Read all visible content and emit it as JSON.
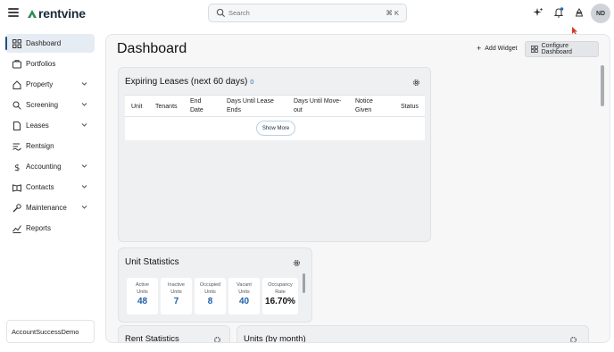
{
  "topbar": {
    "logo": "rentvine",
    "search_placeholder": "Search",
    "search_shortcut": "⌘ K",
    "avatar_initials": "ND",
    "icons": [
      "menu-icon",
      "sparkle-icon",
      "bell-icon",
      "user-icon"
    ],
    "notification_dot_color": "#2a6bb5"
  },
  "sidebar": {
    "items": [
      {
        "label": "Dashboard",
        "icon": "dashboard-icon",
        "active": true
      },
      {
        "label": "Portfolios",
        "icon": "portfolio-icon"
      },
      {
        "label": "Property",
        "icon": "house-icon",
        "expandable": true
      },
      {
        "label": "Screening",
        "icon": "magnifier-icon",
        "expandable": true
      },
      {
        "label": "Leases",
        "icon": "document-icon",
        "expandable": true
      },
      {
        "label": "Rentsign",
        "icon": "sign-icon"
      },
      {
        "label": "Accounting",
        "icon": "dollar-icon",
        "expandable": true
      },
      {
        "label": "Contacts",
        "icon": "contacts-icon",
        "expandable": true
      },
      {
        "label": "Maintenance",
        "icon": "wrench-icon",
        "expandable": true
      },
      {
        "label": "Reports",
        "icon": "chart-icon"
      }
    ],
    "account": "AccountSuccessDemo"
  },
  "main": {
    "title": "Dashboard",
    "add_widget": "Add Widget",
    "configure": "Configure Dashboard",
    "expiring": {
      "title": "Expiring Leases (next 60 days)",
      "count": "0",
      "columns": [
        "Unit",
        "Tenants",
        "End Date",
        "Days Until Lease Ends",
        "Days Until Move-out",
        "Notice Given",
        "Status"
      ],
      "show_more": "Show More"
    },
    "unit_stats": {
      "title": "Unit Statistics",
      "stats": [
        {
          "l1": "Active",
          "l2": "Units",
          "value": "48"
        },
        {
          "l1": "Inactive",
          "l2": "Units",
          "value": "7"
        },
        {
          "l1": "Occupied",
          "l2": "Units",
          "value": "8"
        },
        {
          "l1": "Vacant",
          "l2": "Units",
          "value": "40"
        },
        {
          "l1": "Occupancy",
          "l2": "Rate",
          "value": "16.70%"
        }
      ]
    },
    "bottom_cards": [
      "Rent Statistics",
      "Units (by month)"
    ]
  },
  "colors": {
    "accent": "#1f5fa8",
    "brand_green": "#2e8b57",
    "active_nav_bg": "#e6ecf3"
  }
}
